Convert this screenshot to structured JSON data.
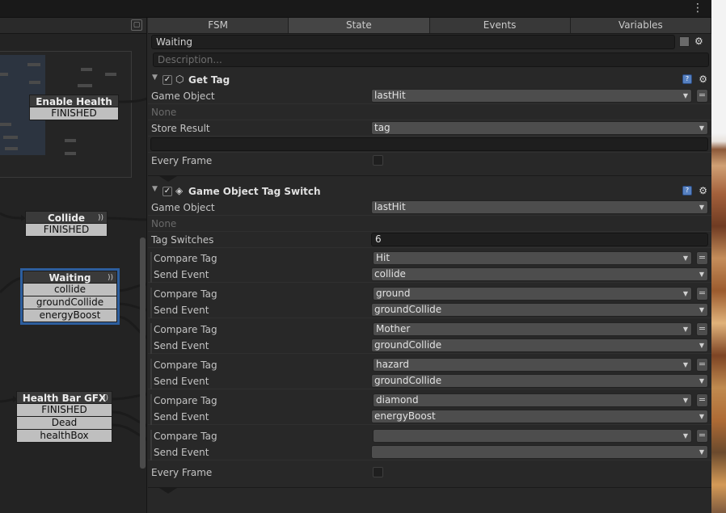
{
  "graph": {
    "nodes": [
      {
        "title": "Enable Health",
        "events": [
          "FINISHED"
        ]
      },
      {
        "title": "Collide",
        "events": [
          "FINISHED"
        ]
      },
      {
        "title": "Waiting",
        "events": [
          "collide",
          "groundCollide",
          "energyBoost"
        ]
      },
      {
        "title": "Health Bar GFX",
        "events": [
          "FINISHED",
          "Dead",
          "healthBox"
        ]
      }
    ]
  },
  "tabs": [
    "FSM",
    "State",
    "Events",
    "Variables"
  ],
  "active_tab": "State",
  "state": {
    "name": "Waiting",
    "description_placeholder": "Description..."
  },
  "actions": [
    {
      "title": "Get Tag",
      "enabled": true,
      "fields": [
        {
          "label": "Game Object",
          "value": "lastHit"
        },
        {
          "label": "None",
          "value": ""
        },
        {
          "label": "Store Result",
          "value": "tag"
        },
        {
          "label": "Every Frame",
          "value": ""
        }
      ]
    },
    {
      "title": "Game Object Tag Switch",
      "enabled": true,
      "game_object_label": "Game Object",
      "game_object_value": "lastHit",
      "none_label": "None",
      "tag_switches_label": "Tag Switches",
      "tag_switches_value": "6",
      "compare_label": "Compare Tag",
      "send_label": "Send Event",
      "switches": [
        {
          "compare": "Hit",
          "send": "collide"
        },
        {
          "compare": "ground",
          "send": "groundCollide"
        },
        {
          "compare": "Mother",
          "send": "groundCollide"
        },
        {
          "compare": "hazard",
          "send": "groundCollide"
        },
        {
          "compare": "diamond",
          "send": "energyBoost"
        },
        {
          "compare": "",
          "send": ""
        }
      ],
      "every_frame_label": "Every Frame"
    }
  ],
  "icons": {
    "kebab": "⋮",
    "gear": "⚙",
    "check": "✓",
    "dropdown": "▼",
    "equals": "="
  }
}
